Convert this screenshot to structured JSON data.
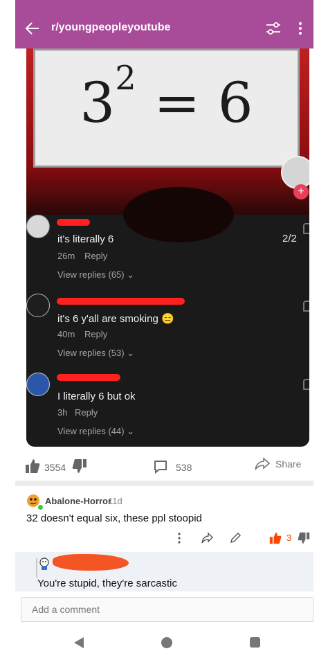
{
  "header": {
    "subreddit": "r/youngpeopleyoutube"
  },
  "media": {
    "equation_base": "3",
    "equation_exponent": "2",
    "equation_rest": " = 6",
    "page_counter": "2/2",
    "comments": [
      {
        "text": "it's literally 6",
        "time": "26m",
        "reply": "Reply",
        "view_replies": "View replies (65)"
      },
      {
        "text": "it's 6 y'all are smoking 😑",
        "time": "40m",
        "reply": "Reply",
        "view_replies": "View replies (53)"
      },
      {
        "text": "I literally 6 but ok",
        "time": "3h",
        "reply": "Reply",
        "view_replies": "View replies (44)"
      }
    ]
  },
  "actions": {
    "upvotes": "3554",
    "comments": "538",
    "share": "Share"
  },
  "comment": {
    "author": "Abalone-Horror",
    "age": "11d",
    "body": "32 doesn't equal six, these ppl stoopid",
    "score": "3"
  },
  "reply": {
    "body": "You're stupid, they're sarcastic"
  },
  "composer": {
    "placeholder": "Add a comment"
  },
  "colors": {
    "header_bg": "#a84b99",
    "upvote_accent": "#ff4500",
    "redaction": "#ff2020"
  }
}
